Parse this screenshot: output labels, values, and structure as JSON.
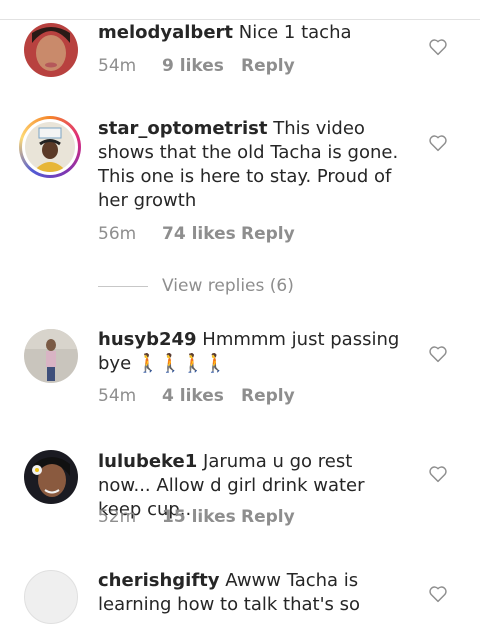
{
  "comments": [
    {
      "username": "melodyalbert",
      "text": "Nice 1 tacha",
      "time": "54m",
      "likes": "9 likes",
      "reply": "Reply"
    },
    {
      "username": "star_optometrist",
      "text": "This video shows that the old Tacha is gone. This one is here to stay. Proud of her growth",
      "time": "56m",
      "likes": "74 likes",
      "reply": "Reply"
    },
    {
      "username": "husyb249",
      "text": "Hmmmm just passing bye",
      "emoji": "🚶🚶🚶🚶",
      "time": "54m",
      "likes": "4 likes",
      "reply": "Reply"
    },
    {
      "username": "lulubeke1",
      "text": "Jaruma u go rest now... Allow d girl drink water keep cup..",
      "time": "52m",
      "likes": "15 likes",
      "reply": "Reply"
    },
    {
      "username": "cherishgifty",
      "text": "Awww Tacha is learning how to talk that's so"
    }
  ],
  "view_replies": "View replies (6)",
  "colors": {
    "text": "#262626",
    "meta": "#8e8e8e",
    "emoji": "#f4c20d"
  }
}
